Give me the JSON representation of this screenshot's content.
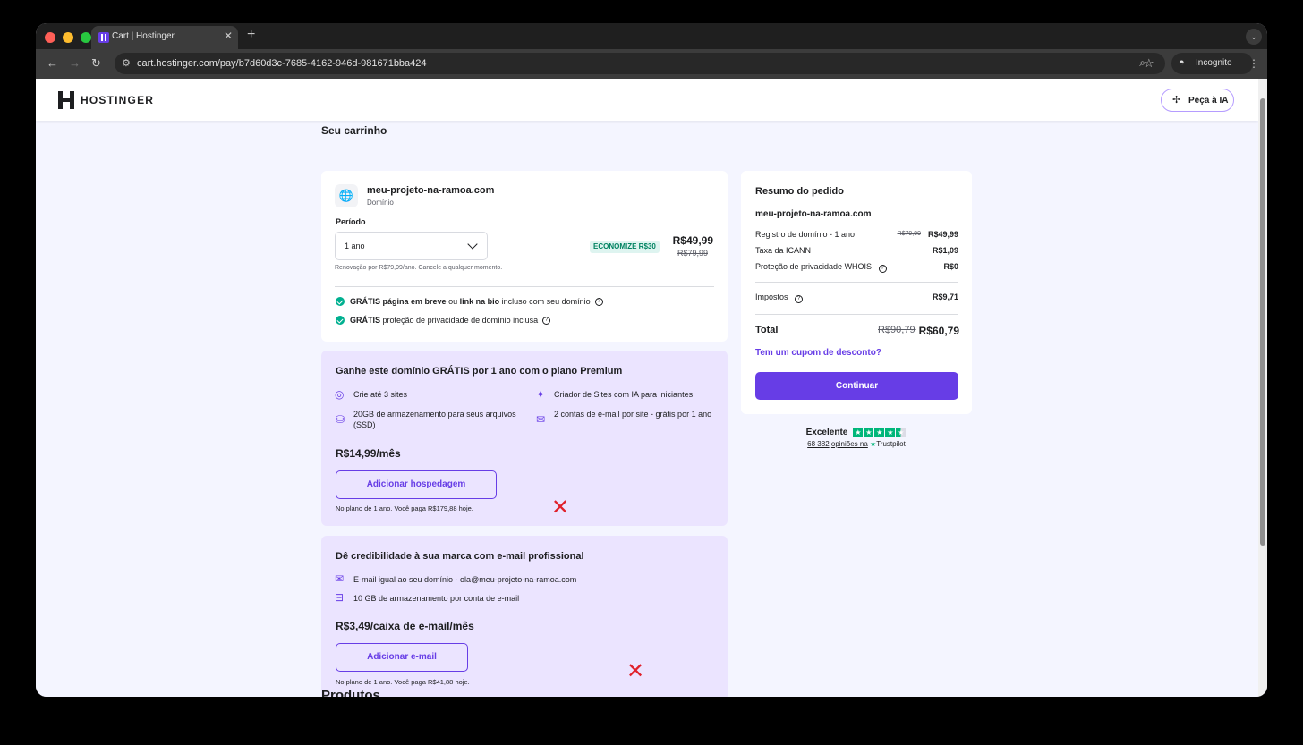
{
  "browser": {
    "tab_title": "Cart | Hostinger",
    "url": "cart.hostinger.com/pay/b7d60d3c-7685-4162-946d-981671bba424",
    "incognito_label": "Incognito"
  },
  "header": {
    "logo_text": "HOSTINGER",
    "ai_button": "Peça à IA"
  },
  "cart": {
    "title": "Seu carrinho",
    "domain": {
      "name": "meu-projeto-na-ramoa.com",
      "type": "Domínio",
      "period_label": "Período",
      "period_value": "1 ano",
      "badge": "ECONOMIZE R$30",
      "price": "R$49,99",
      "price_old": "R$79,99",
      "renewal": "Renovação por R$79,99/ano. Cancele a qualquer momento.",
      "perk1_bold": "GRÁTIS",
      "perk1_a": "página em breve",
      "perk1_or": "ou",
      "perk1_b": "link na bio",
      "perk1_rest": "incluso com seu domínio",
      "perk2_bold": "GRÁTIS",
      "perk2_rest": "proteção de privacidade de domínio inclusa"
    },
    "hosting_promo": {
      "title": "Ganhe este domínio GRÁTIS por 1 ano com o plano Premium",
      "f1": "Crie até 3 sites",
      "f2": "Criador de Sites com IA para iniciantes",
      "f3": "20GB de armazenamento para seus arquivos (SSD)",
      "f4": "2 contas de e-mail por site - grátis por 1 ano",
      "price": "R$14,99/mês",
      "button": "Adicionar hospedagem",
      "note": "No plano de 1 ano. Você paga R$179,88 hoje."
    },
    "email_promo": {
      "title": "Dê credibilidade à sua marca com e-mail profissional",
      "f1": "E-mail igual ao seu domínio - ola@meu-projeto-na-ramoa.com",
      "f2": "10 GB de armazenamento por conta de e-mail",
      "price": "R$3,49/caixa de e-mail/mês",
      "button": "Adicionar e-mail",
      "note": "No plano de 1 ano. Você paga R$41,88 hoje."
    },
    "next_section_peek": "Produtos"
  },
  "summary": {
    "title": "Resumo do pedido",
    "domain": "meu-projeto-na-ramoa.com",
    "rows": [
      {
        "label": "Registro de domínio - 1 ano",
        "old": "R$79,99",
        "value": "R$49,99"
      },
      {
        "label": "Taxa da ICANN",
        "value": "R$1,09"
      },
      {
        "label": "Proteção de privacidade WHOIS",
        "value": "R$0"
      },
      {
        "label": "Impostos",
        "value": "R$9,71"
      }
    ],
    "total_label": "Total",
    "total_old": "R$90,79",
    "total": "R$60,79",
    "coupon": "Tem um cupom de desconto?",
    "continue": "Continuar"
  },
  "trustpilot": {
    "rating_word": "Excelente",
    "reviews_count": "68 382",
    "reviews_suffix": "opiniões na",
    "brand": "Trustpilot",
    "stars": 4.5
  },
  "colors": {
    "accent": "#673de6",
    "promo_bg": "#ebe4ff",
    "page_bg": "#f4f5ff",
    "success": "#00b090",
    "annotation_x": "#e0212b"
  }
}
